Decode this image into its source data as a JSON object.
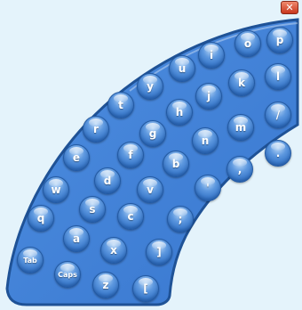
{
  "window": {
    "close_label": "✕"
  },
  "keys": [
    {
      "label": "p",
      "name": "key-p"
    },
    {
      "label": "o",
      "name": "key-o"
    },
    {
      "label": "i",
      "name": "key-i"
    },
    {
      "label": "u",
      "name": "key-u"
    },
    {
      "label": "y",
      "name": "key-y"
    },
    {
      "label": "l",
      "name": "key-l"
    },
    {
      "label": "k",
      "name": "key-k"
    },
    {
      "label": "j",
      "name": "key-j"
    },
    {
      "label": "t",
      "name": "key-t"
    },
    {
      "label": "h",
      "name": "key-h"
    },
    {
      "label": "/",
      "name": "key-slash"
    },
    {
      "label": "m",
      "name": "key-m"
    },
    {
      "label": "r",
      "name": "key-r"
    },
    {
      "label": "g",
      "name": "key-g"
    },
    {
      "label": "n",
      "name": "key-n"
    },
    {
      "label": ".",
      "name": "key-period"
    },
    {
      "label": "e",
      "name": "key-e"
    },
    {
      "label": "f",
      "name": "key-f"
    },
    {
      "label": "b",
      "name": "key-b"
    },
    {
      "label": ",",
      "name": "key-comma"
    },
    {
      "label": "d",
      "name": "key-d"
    },
    {
      "label": "w",
      "name": "key-w"
    },
    {
      "label": "v",
      "name": "key-v"
    },
    {
      "label": "'",
      "name": "key-apostrophe"
    },
    {
      "label": "s",
      "name": "key-s"
    },
    {
      "label": "q",
      "name": "key-q"
    },
    {
      "label": "c",
      "name": "key-c"
    },
    {
      "label": ";",
      "name": "key-semicolon"
    },
    {
      "label": "a",
      "name": "key-a"
    },
    {
      "label": "x",
      "name": "key-x"
    },
    {
      "label": "]",
      "name": "key-right-bracket"
    },
    {
      "label": "Tab",
      "name": "key-tab"
    },
    {
      "label": "Caps",
      "name": "key-caps"
    },
    {
      "label": "z",
      "name": "key-z"
    },
    {
      "label": "[",
      "name": "key-left-bracket"
    }
  ]
}
